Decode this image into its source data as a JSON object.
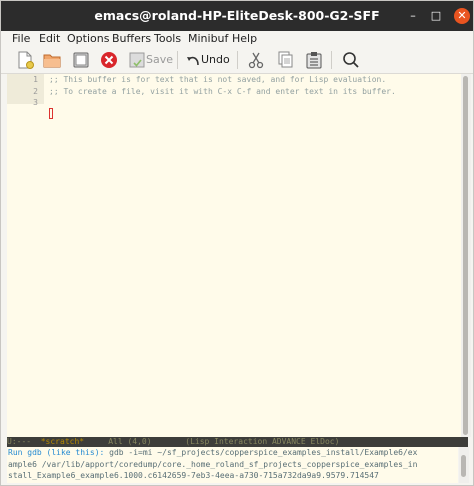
{
  "window": {
    "title": "emacs@roland-HP-EliteDesk-800-G2-SFF",
    "close_glyph": "✕",
    "minimize_glyph": "–",
    "maximize_glyph": "□"
  },
  "menubar": {
    "items": [
      "File",
      "Edit",
      "Options",
      "Buffers",
      "Tools",
      "Minibuf",
      "Help"
    ]
  },
  "toolbar": {
    "icons": [
      "new-file-icon",
      "open-folder-icon",
      "dired-icon",
      "close-buffer-icon",
      "save-icon",
      "undo-icon",
      "cut-icon",
      "copy-icon",
      "paste-icon",
      "search-icon"
    ],
    "save_label": "Save",
    "undo_label": "Undo"
  },
  "editor": {
    "lines": [
      {
        "number": "1",
        "text": ";; This buffer is for text that is not saved, and for Lisp evaluation."
      },
      {
        "number": "2",
        "text": ";; To create a file, visit it with C-x C-f and enter text in its buffer."
      },
      {
        "number": "3",
        "text": ""
      }
    ]
  },
  "modeline": {
    "status": "U:---",
    "buffer_name": "*scratch*",
    "position": "All (4,0)",
    "modes": "(Lisp Interaction ADVANCE ElDoc)"
  },
  "minibuffer": {
    "prompt": "Run gdb (like this):",
    "line1": " gdb -i=mi ~/sf_projects/copperspice_examples_install/Example6/ex",
    "line2": "ample6 /var/lib/apport/coredump/core._home_roland_sf_projects_copperspice_examples_in",
    "line3": "stall_Example6_example6.1000.c6142659-7eb3-4eea-a730-715a732da9a9.9579.714547"
  },
  "colors": {
    "titlebar_bg": "#2c2c2c",
    "close_button": "#e95420",
    "editor_bg": "#fffbea",
    "comment_text": "#93a1a1",
    "modeline_bg": "#3d3d3a",
    "buffer_name": "#b58900",
    "prompt": "#268bd2"
  }
}
